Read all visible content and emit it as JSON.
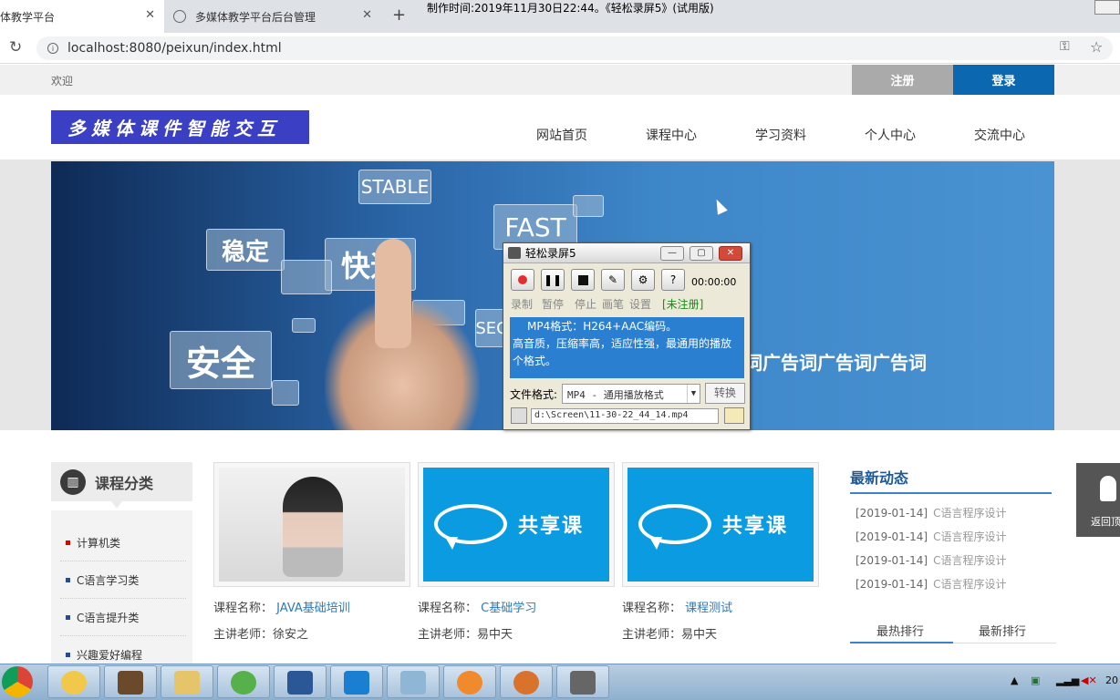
{
  "browser": {
    "tabs": [
      {
        "title": "体教学平台",
        "active": true
      },
      {
        "title": "多媒体教学平台后台管理",
        "active": false
      }
    ],
    "url": "localhost:8080/peixun/index.html",
    "watermark": "制作时间:2019年11月30日22:44。《轻松录屏5》(试用版)"
  },
  "site": {
    "welcome": "欢迎",
    "register": "注册",
    "login": "登录",
    "logo_text": "多媒体课件智能交互",
    "nav": [
      "网站首页",
      "课程中心",
      "学习资料",
      "个人中心",
      "交流中心"
    ],
    "banner": {
      "chips": [
        "STABLE",
        "FAST",
        "稳定",
        "快速",
        "安全",
        "SEC"
      ],
      "slogan": "词广告词广告词广告词"
    },
    "category": {
      "title": "课程分类",
      "items": [
        "计算机类",
        "C语言学习类",
        "C语言提升类",
        "兴趣爱好编程"
      ]
    },
    "courses": [
      {
        "name_label": "课程名称：",
        "name": "JAVA基础培训",
        "teacher_label": "主讲老师：",
        "teacher": "徐安之",
        "image": "photo"
      },
      {
        "name_label": "课程名称：",
        "name": "C基础学习",
        "teacher_label": "主讲老师：",
        "teacher": "易中天",
        "image": "share"
      },
      {
        "name_label": "课程名称：",
        "name": "课程测试",
        "teacher_label": "主讲老师：",
        "teacher": "易中天",
        "image": "share"
      }
    ],
    "share_text": "共享课",
    "news": {
      "title": "最新动态",
      "items": [
        {
          "date": "[2019-01-14]",
          "title": "C语言程序设计"
        },
        {
          "date": "[2019-01-14]",
          "title": "C语言程序设计"
        },
        {
          "date": "[2019-01-14]",
          "title": "C语言程序设计"
        },
        {
          "date": "[2019-01-14]",
          "title": "C语言程序设计"
        }
      ]
    },
    "rank_tabs": [
      "最热排行",
      "最新排行"
    ],
    "back_top": "返回顶"
  },
  "recorder": {
    "title": "轻松录屏5",
    "time": "00:00:00",
    "labels": [
      "录制",
      "暂停",
      "停止",
      "画笔",
      "设置"
    ],
    "unregistered": "[未注册]",
    "desc_line1": "MP4格式：H264+AAC编码。",
    "desc_line2": "高音质，压缩率高，适应性强，最通用的播放个格式。",
    "format_label": "文件格式:",
    "format_value": "MP4 - 通用播放格式",
    "convert": "转换",
    "path": "d:\\Screen\\11-30-22_44_14.mp4"
  },
  "taskbar": {
    "clock": "20"
  }
}
